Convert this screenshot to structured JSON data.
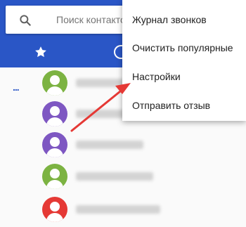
{
  "search": {
    "placeholder": "Поиск контактов и"
  },
  "tabs": [
    {
      "icon": "star-icon"
    },
    {
      "icon": "clock-icon"
    }
  ],
  "favorites_marker": "...",
  "contacts": [
    {
      "avatar_color": "#7cb342"
    },
    {
      "avatar_color": "#7e57c2"
    },
    {
      "avatar_color": "#7e57c2"
    },
    {
      "avatar_color": "#7cb342"
    },
    {
      "avatar_color": "#e53935"
    }
  ],
  "menu": {
    "items": [
      {
        "label": "Журнал звонков"
      },
      {
        "label": "Очистить популярные"
      },
      {
        "label": "Настройки"
      },
      {
        "label": "Отправить отзыв"
      }
    ]
  },
  "colors": {
    "appbar": "#2a56c6",
    "arrow": "#e53935"
  }
}
